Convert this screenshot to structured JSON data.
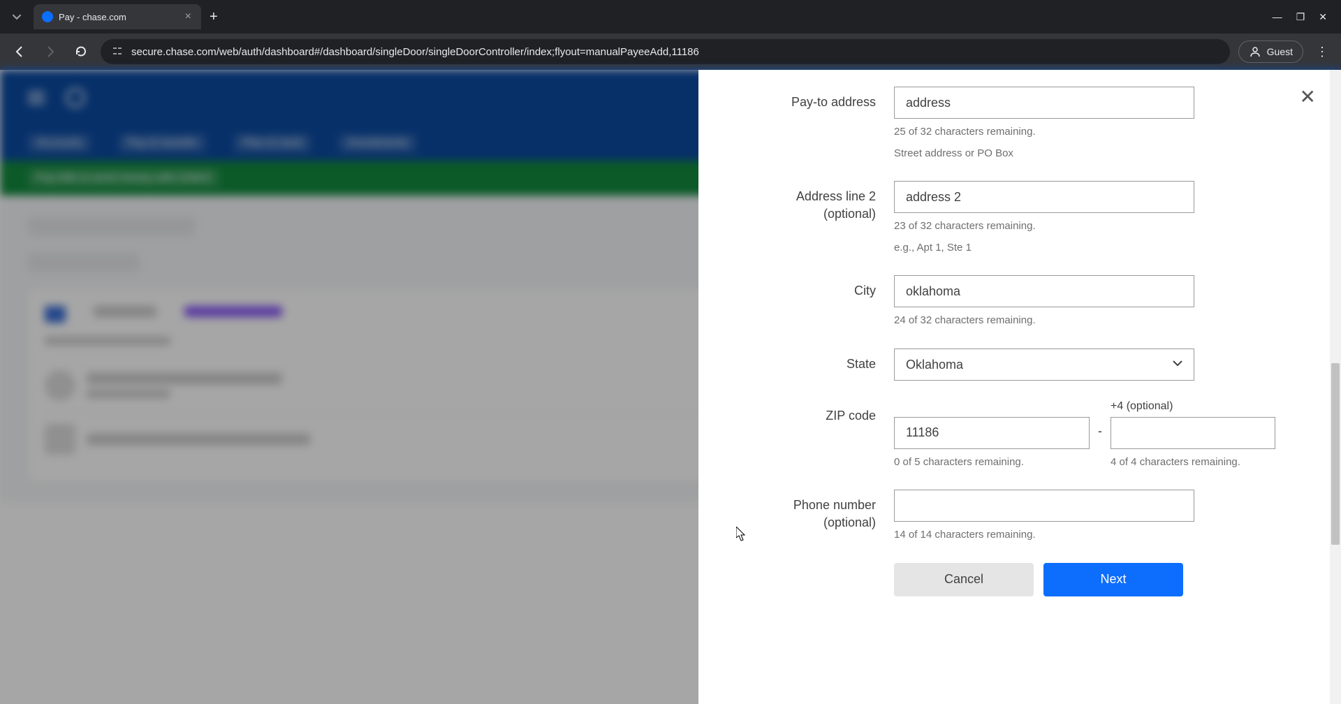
{
  "browser": {
    "tab_title": "Pay - chase.com",
    "url": "secure.chase.com/web/auth/dashboard#/dashboard/singleDoor/singleDoorController/index;flyout=manualPayeeAdd,11186",
    "guest_label": "Guest"
  },
  "form": {
    "pay_to_address": {
      "label": "Pay-to address",
      "value": "address",
      "helper_count": "25 of 32 characters remaining.",
      "helper_desc": "Street address or PO Box"
    },
    "address_line_2": {
      "label": "Address line 2 (optional)",
      "value": "address 2",
      "helper_count": "23 of 32 characters remaining.",
      "helper_desc": "e.g., Apt 1, Ste 1"
    },
    "city": {
      "label": "City",
      "value": "oklahoma",
      "helper_count": "24 of 32 characters remaining."
    },
    "state": {
      "label": "State",
      "value": "Oklahoma"
    },
    "zip": {
      "label": "ZIP code",
      "value": "11186",
      "helper_count": "0 of 5 characters remaining.",
      "plus4_label": "+4 (optional)",
      "plus4_value": "",
      "plus4_helper": "4 of 4 characters remaining."
    },
    "phone": {
      "label": "Phone number (optional)",
      "value": "",
      "helper_count": "14 of 14 characters remaining."
    },
    "cancel_label": "Cancel",
    "next_label": "Next"
  }
}
